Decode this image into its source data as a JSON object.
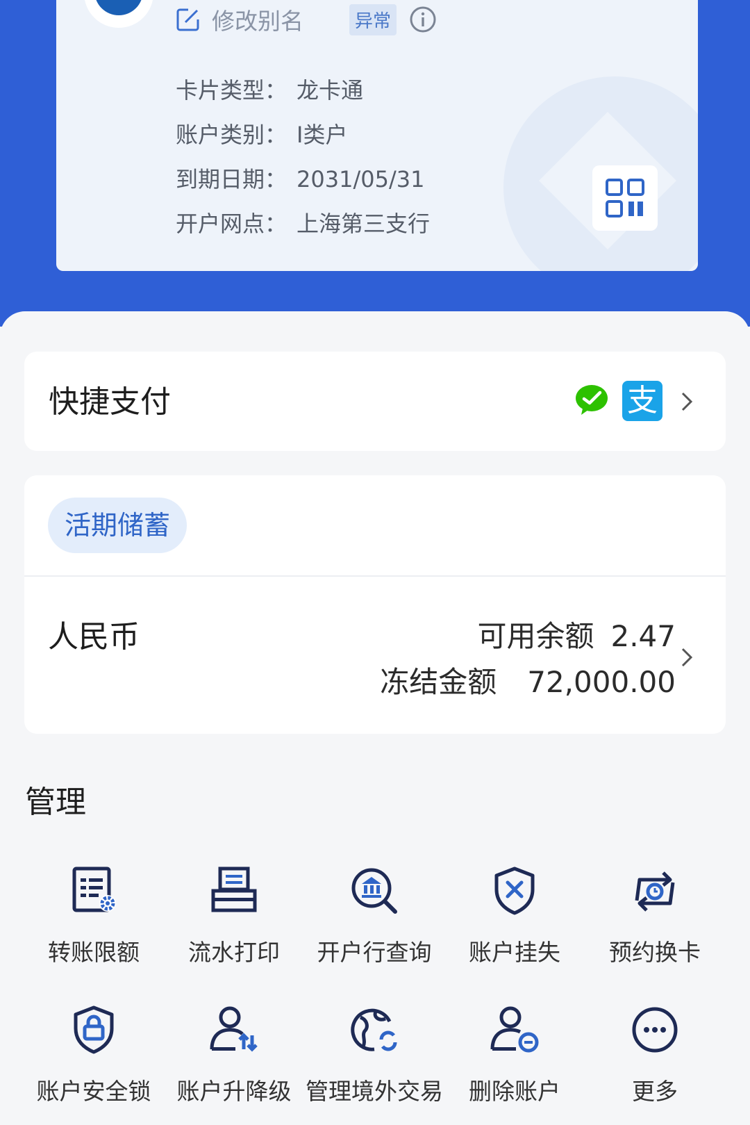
{
  "card": {
    "alias_label": "修改别名",
    "status_badge": "异常",
    "rows": [
      {
        "label": "卡片类型：",
        "value": "龙卡通"
      },
      {
        "label": "账户类别：",
        "value": "I类户"
      },
      {
        "label": "到期日期：",
        "value": "2031/05/31"
      },
      {
        "label": "开户网点：",
        "value": "上海第三支行"
      }
    ]
  },
  "quick_pay": {
    "title": "快捷支付",
    "alipay_glyph": "支"
  },
  "savings": {
    "tag": "活期储蓄",
    "currency": "人民币",
    "available_label": "可用余额",
    "available_value": "2.47",
    "frozen_label": "冻结金额",
    "frozen_value": "72,000.00"
  },
  "management": {
    "title": "管理",
    "items": [
      {
        "label": "转账限额",
        "icon": "transfer-limit-icon"
      },
      {
        "label": "流水打印",
        "icon": "printer-icon"
      },
      {
        "label": "开户行查询",
        "icon": "bank-search-icon"
      },
      {
        "label": "账户挂失",
        "icon": "shield-x-icon"
      },
      {
        "label": "预约换卡",
        "icon": "card-swap-icon"
      },
      {
        "label": "账户安全锁",
        "icon": "shield-lock-icon"
      },
      {
        "label": "账户升降级",
        "icon": "user-updown-icon"
      },
      {
        "label": "管理境外交易",
        "icon": "globe-refresh-icon"
      },
      {
        "label": "删除账户",
        "icon": "user-minus-icon"
      },
      {
        "label": "更多",
        "icon": "more-icon"
      }
    ]
  },
  "colors": {
    "header_blue": "#2f5fd6",
    "accent_blue": "#2f65c7",
    "icon_navy": "#1e2a55",
    "wechat_green": "#2dc100",
    "alipay_blue": "#1aa3e8"
  }
}
